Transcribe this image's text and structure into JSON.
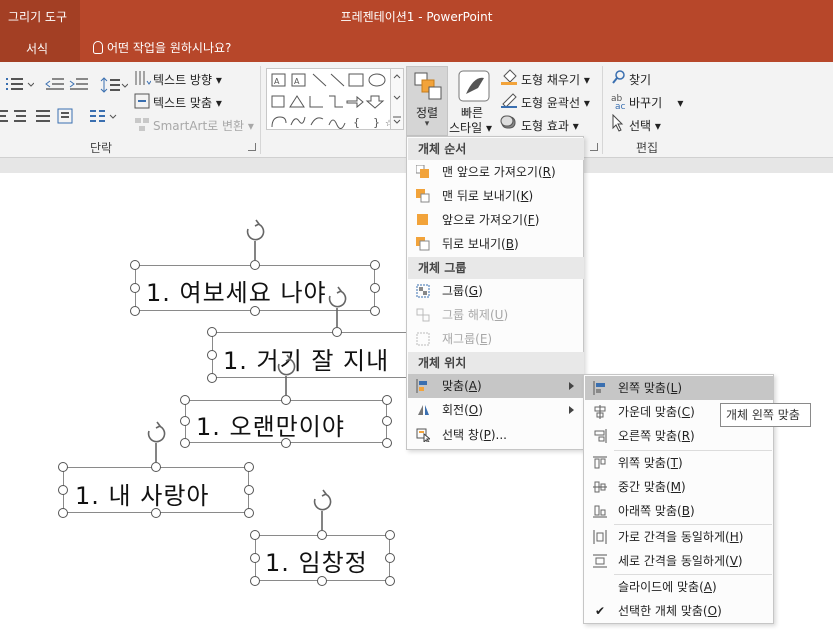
{
  "titlebar": {
    "context_group": "그리기 도구",
    "title": "프레젠테이션1  -  PowerPoint"
  },
  "tabs": {
    "format": "서식",
    "tell_me": "어떤 작업을 원하시나요?"
  },
  "ribbon": {
    "paragraph": {
      "text_direction": "텍스트 방향",
      "align_text": "텍스트 맞춤",
      "smartart": "SmartArt로 변환",
      "label": "단락"
    },
    "arrange": {
      "label": "정렬"
    },
    "quick_styles": {
      "line1": "빠른",
      "line2": "스타일"
    },
    "shape_styles": {
      "fill": "도형 채우기",
      "outline": "도형 윤곽선",
      "effects": "도형 효과"
    },
    "editing": {
      "find": "찾기",
      "replace": "바꾸기",
      "select": "선택",
      "label": "편집"
    }
  },
  "arrange_menu": {
    "order_header": "개체 순서",
    "bring_to_front": "맨 앞으로 가져오기",
    "bring_to_front_key": "R",
    "send_to_back": "맨 뒤로 보내기",
    "send_to_back_key": "K",
    "bring_forward": "앞으로 가져오기",
    "bring_forward_key": "F",
    "send_backward": "뒤로 보내기",
    "send_backward_key": "B",
    "group_header": "개체 그룹",
    "group": "그룹",
    "group_key": "G",
    "ungroup": "그룹 해제",
    "ungroup_key": "U",
    "regroup": "재그룹",
    "regroup_key": "E",
    "position_header": "개체 위치",
    "align": "맞춤",
    "align_key": "A",
    "rotate": "회전",
    "rotate_key": "O",
    "selection_pane": "선택 창",
    "selection_pane_key": "P"
  },
  "align_submenu": {
    "left": "왼쪽 맞춤",
    "left_key": "L",
    "center": "가운데 맞춤",
    "center_key": "C",
    "right": "오른쪽 맞춤",
    "right_key": "R",
    "top": "위쪽 맞춤",
    "top_key": "T",
    "middle": "중간 맞춤",
    "middle_key": "M",
    "bottom": "아래쪽 맞춤",
    "bottom_key": "B",
    "distribute_h": "가로 간격을 동일하게",
    "distribute_h_key": "H",
    "distribute_v": "세로 간격을 동일하게",
    "distribute_v_key": "V",
    "to_slide": "슬라이드에 맞춤",
    "to_slide_key": "A",
    "selected": "선택한 개체 맞춤",
    "selected_key": "O",
    "selected_check": "✔"
  },
  "tooltip": "개체 왼쪽 맞춤",
  "slide": {
    "boxes": [
      {
        "text": "1.  여보세요 나야"
      },
      {
        "text": "1.  거기 잘 지내"
      },
      {
        "text": "1.  오랜만이야"
      },
      {
        "text": "1.  내 사랑아"
      },
      {
        "text": "1. 임창정"
      }
    ]
  }
}
